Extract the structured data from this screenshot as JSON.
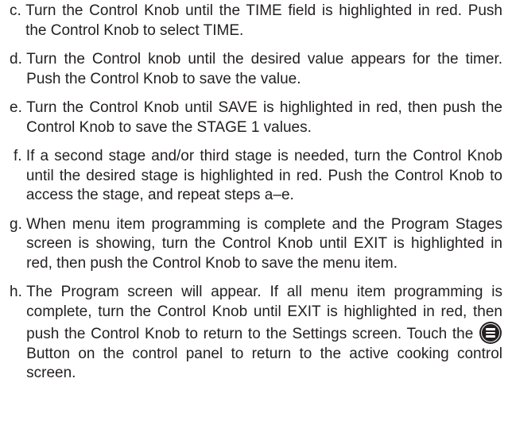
{
  "steps": [
    {
      "letter": "c.",
      "text": "Turn the Control Knob until the TIME field is highlighted in red. Push the Control Knob to select TIME."
    },
    {
      "letter": "d.",
      "text": "Turn the Control knob until the desired value appears for the timer. Push the Control Knob to save the value."
    },
    {
      "letter": "e.",
      "text": "Turn the Control Knob until SAVE is highlighted in red, then push the Control Knob to save the STAGE 1 values."
    },
    {
      "letter": "f.",
      "text": "If a second stage and/or third stage is needed, turn the Control Knob until the desired stage is highlighted in red. Push the Control Knob to access the stage, and repeat steps a–e."
    },
    {
      "letter": "g.",
      "text": "When menu item programming is complete and the Program Stages screen is showing, turn the Control Knob until EXIT is highlighted in red, then push the Control Knob to save the menu item."
    },
    {
      "letter": "h.",
      "text_before_icon": "The Program screen will appear. If all menu item programming is complete, turn the Control Knob until EXIT is highlighted in red, then push the Control Knob to return to the Settings screen. Touch the",
      "icon": "menu-button-icon",
      "text_after_icon": "Button on the control panel to return to the active cooking control screen."
    }
  ]
}
